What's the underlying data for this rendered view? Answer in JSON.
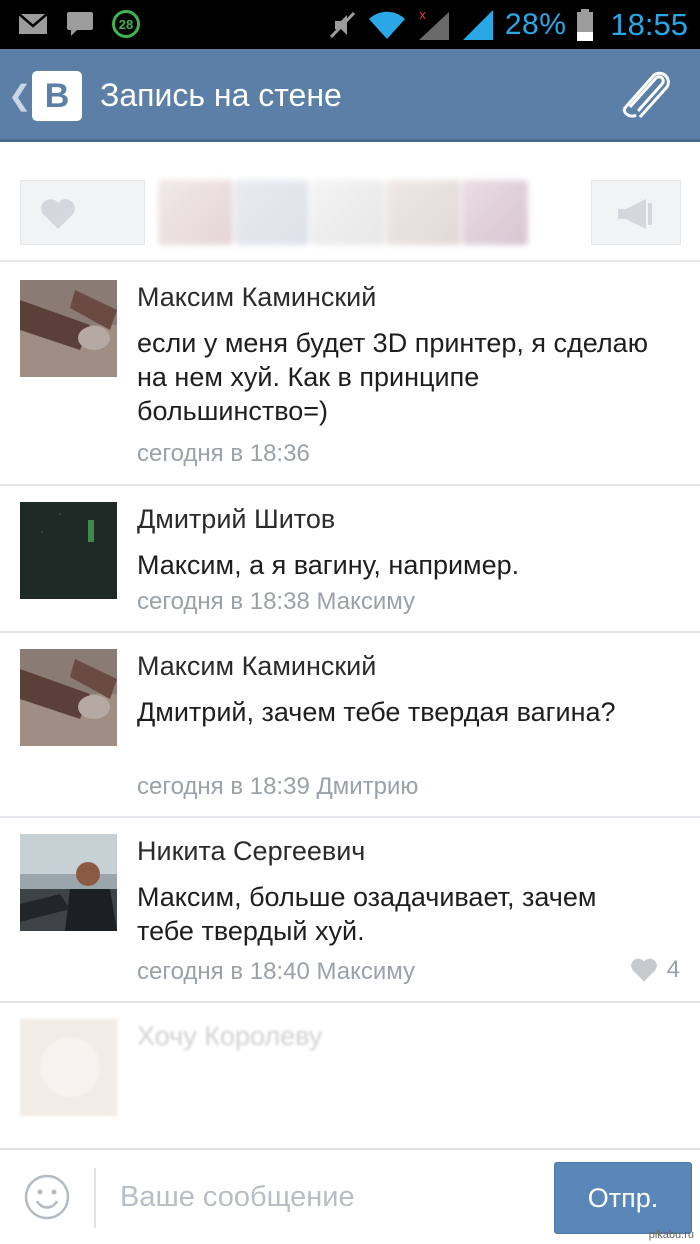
{
  "status_bar": {
    "notification_count": "28",
    "battery": "28%",
    "time": "18:55"
  },
  "header": {
    "title": "Запись на стене",
    "logo_letter": "B"
  },
  "comments": [
    {
      "author": "Максим Каминский",
      "text": "если у меня будет 3D принтер, я сделаю на нем хуй. Как в принципе большинство=)",
      "meta": "сегодня в 18:36"
    },
    {
      "author": "Дмитрий Шитов",
      "text": "Максим, а я вагину, например.",
      "meta": "сегодня в 18:38 Максиму"
    },
    {
      "author": "Максим Каминский",
      "text": "Дмитрий, зачем тебе твердая вагина?",
      "meta": "сегодня в 18:39 Дмитрию"
    },
    {
      "author": "Никита Сергеевич",
      "text": "Максим, больше озадачивает, зачем тебе твердый хуй.",
      "meta": "сегодня в 18:40 Максиму",
      "likes": "4"
    },
    {
      "author": "Хочу Королеву",
      "text": "",
      "meta": ""
    }
  ],
  "input": {
    "placeholder": "Ваше сообщение",
    "send_label": "Отпр."
  },
  "watermark": "pikabu.ru",
  "colors": {
    "header_bg": "#5b7fa6",
    "accent": "#2aa7e6",
    "send_button": "#5b86b8",
    "meta_text": "#9aa1a9"
  }
}
